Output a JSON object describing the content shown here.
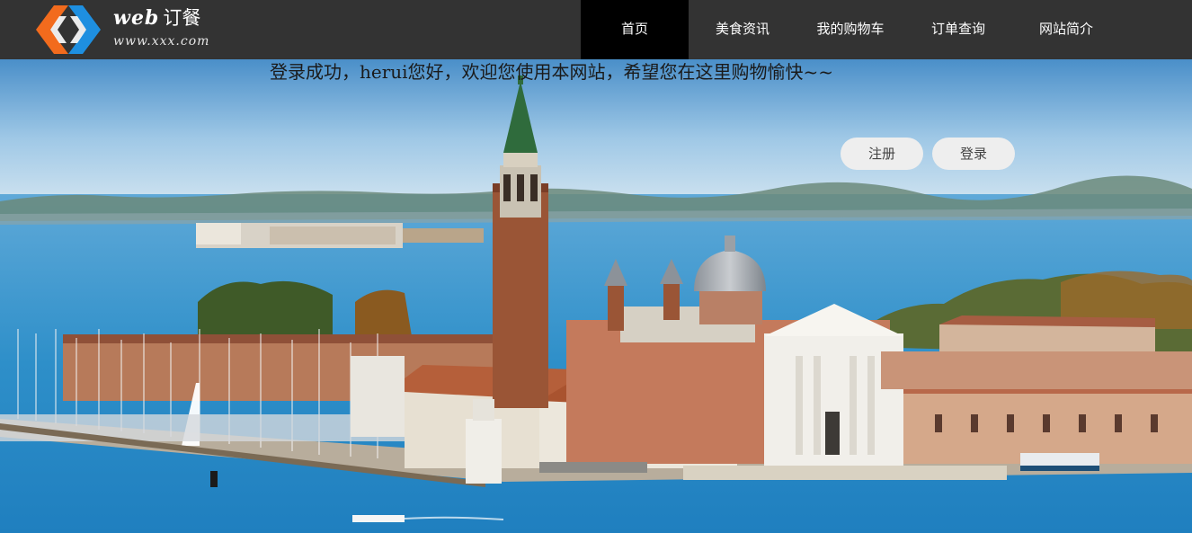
{
  "header": {
    "logo": {
      "title_en": "web",
      "title_cn": "订餐",
      "url": "www.xxx.com"
    },
    "nav": [
      {
        "label": "首页",
        "active": true
      },
      {
        "label": "美食资讯",
        "active": false
      },
      {
        "label": "我的购物车",
        "active": false
      },
      {
        "label": "订单查询",
        "active": false
      },
      {
        "label": "网站简介",
        "active": false
      }
    ]
  },
  "main": {
    "welcome_text": "登录成功，herui您好，欢迎您使用本网站，希望您在这里购物愉快~~",
    "register_label": "注册",
    "login_label": "登录",
    "hero_image": "venice-island-banner"
  },
  "colors": {
    "header_bg": "#333333",
    "nav_active_bg": "#000000",
    "logo_orange": "#f26b1d",
    "logo_blue": "#1e8fe0",
    "button_bg": "#eeeeee"
  }
}
